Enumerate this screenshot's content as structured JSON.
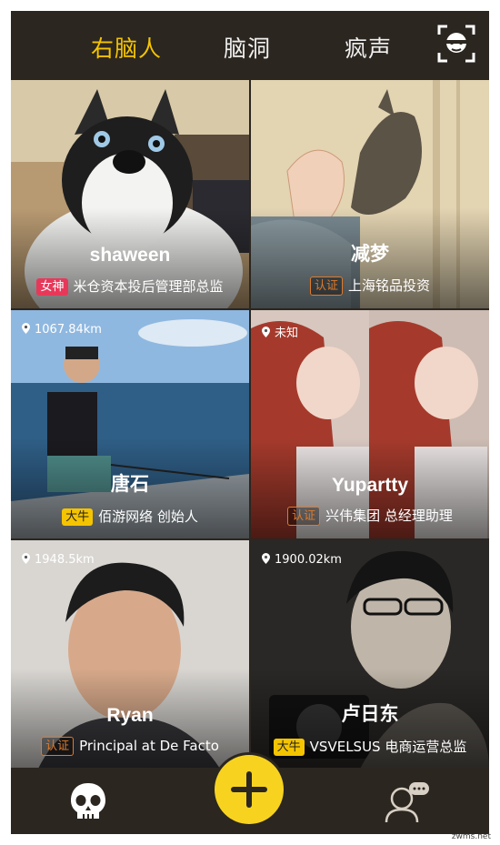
{
  "header": {
    "tabs": [
      {
        "label": "右脑人",
        "active": true
      },
      {
        "label": "脑洞",
        "active": false
      },
      {
        "label": "疯声",
        "active": false
      }
    ],
    "scan_icon": "face-scan-icon"
  },
  "cards": [
    {
      "name": "shaween",
      "badge": "女神",
      "badge_type": "goddess",
      "title": "米仓资本投后管理部总监",
      "distance": ""
    },
    {
      "name": "减梦",
      "badge": "认证",
      "badge_type": "cert",
      "title": "上海铭品投资",
      "distance": ""
    },
    {
      "name": "唐石",
      "badge": "大牛",
      "badge_type": "boss",
      "title": "佰游网络 创始人",
      "distance": "1067.84km"
    },
    {
      "name": "Yupartty",
      "badge": "认证",
      "badge_type": "cert",
      "title": "兴伟集团 总经理助理",
      "distance": "未知"
    },
    {
      "name": "Ryan",
      "badge": "认证",
      "badge_type": "cert",
      "title": "Principal at De Facto",
      "distance": "1948.5km"
    },
    {
      "name": "卢日东",
      "badge": "大牛",
      "badge_type": "boss",
      "title": "VSVELSUS 电商运营总监",
      "distance": "1900.02km"
    }
  ],
  "bottom_nav": {
    "left_icon": "skull-icon",
    "center_icon": "plus-icon",
    "right_icon": "chat-user-icon"
  },
  "colors": {
    "accent": "#f5c400",
    "bar": "#2b2620",
    "goddess": "#e8385a",
    "cert": "#e07a2a"
  },
  "watermark": "zwms.net"
}
